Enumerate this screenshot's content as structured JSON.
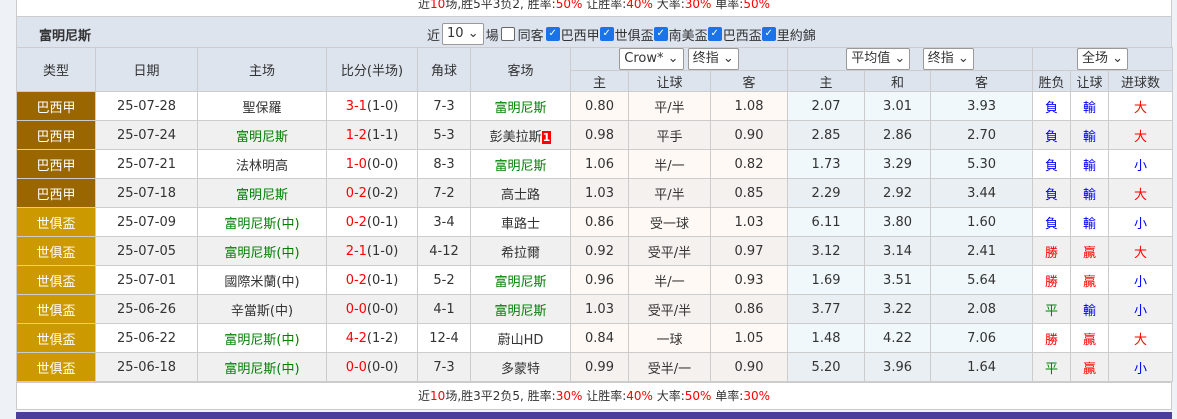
{
  "top_summary": {
    "p1": "近",
    "n": "10",
    "p2": "场,胜5平3负2, 胜率:",
    "win": "50%",
    "p3": " 让胜率:",
    "hwin": "40%",
    "p4": " 大率:",
    "big": "30%",
    "p5": " 单率:",
    "odd": "50%"
  },
  "bar": {
    "title": "富明尼斯",
    "near_label": "近",
    "count": "10",
    "games_label": "場",
    "same_away": "同客",
    "filters": [
      "巴西甲",
      "世俱盃",
      "南美盃",
      "巴西盃",
      "里約錦"
    ]
  },
  "header": {
    "type": "类型",
    "date": "日期",
    "home": "主场",
    "score": "比分(半场)",
    "corner": "角球",
    "away": "客场",
    "company": "Crow*",
    "odds_kind1": "终指",
    "avg": "平均值",
    "odds_kind2": "终指",
    "period": "全场",
    "sub": [
      "主",
      "让球",
      "客",
      "主",
      "和",
      "客",
      "胜负",
      "让球",
      "进球数"
    ]
  },
  "colors": {
    "巴西甲": "#996600",
    "世俱盃": "#cc9900",
    "win": "#ff0000",
    "draw": "#008000",
    "lose": "#0000ff"
  },
  "rows": [
    {
      "league": "巴西甲",
      "date": "25-07-28",
      "home": "聖保羅",
      "home_hl": false,
      "score": "3-1",
      "half": "(1-0)",
      "corner": "7-3",
      "away": "富明尼斯",
      "away_hl": true,
      "o": [
        "0.80",
        "平/半",
        "1.08",
        "2.07",
        "3.01",
        "3.93"
      ],
      "r": [
        "負",
        "輸",
        "大"
      ]
    },
    {
      "league": "巴西甲",
      "date": "25-07-24",
      "home": "富明尼斯",
      "home_hl": true,
      "score": "1-2",
      "half": "(1-1)",
      "corner": "5-3",
      "away": "彭美拉斯",
      "away_hl": false,
      "red_card": "1",
      "o": [
        "0.98",
        "平手",
        "0.90",
        "2.85",
        "2.86",
        "2.70"
      ],
      "r": [
        "負",
        "輸",
        "大"
      ]
    },
    {
      "league": "巴西甲",
      "date": "25-07-21",
      "home": "法林明高",
      "home_hl": false,
      "score": "1-0",
      "half": "(0-0)",
      "corner": "8-3",
      "away": "富明尼斯",
      "away_hl": true,
      "o": [
        "1.06",
        "半/一",
        "0.82",
        "1.73",
        "3.29",
        "5.30"
      ],
      "r": [
        "負",
        "輸",
        "小"
      ]
    },
    {
      "league": "巴西甲",
      "date": "25-07-18",
      "home": "富明尼斯",
      "home_hl": true,
      "score": "0-2",
      "half": "(0-2)",
      "corner": "7-2",
      "away": "高士路",
      "away_hl": false,
      "o": [
        "1.03",
        "平/半",
        "0.85",
        "2.29",
        "2.92",
        "3.44"
      ],
      "r": [
        "負",
        "輸",
        "大"
      ]
    },
    {
      "league": "世俱盃",
      "date": "25-07-09",
      "home": "富明尼斯(中)",
      "home_hl": true,
      "score": "0-2",
      "half": "(0-1)",
      "corner": "3-4",
      "away": "車路士",
      "away_hl": false,
      "o": [
        "0.86",
        "受一球",
        "1.03",
        "6.11",
        "3.80",
        "1.60"
      ],
      "r": [
        "負",
        "輸",
        "小"
      ]
    },
    {
      "league": "世俱盃",
      "date": "25-07-05",
      "home": "富明尼斯(中)",
      "home_hl": true,
      "score": "2-1",
      "half": "(1-0)",
      "corner": "4-12",
      "away": "希拉爾",
      "away_hl": false,
      "o": [
        "0.92",
        "受平/半",
        "0.97",
        "3.12",
        "3.14",
        "2.41"
      ],
      "r": [
        "勝",
        "贏",
        "大"
      ]
    },
    {
      "league": "世俱盃",
      "date": "25-07-01",
      "home": "國際米蘭(中)",
      "home_hl": false,
      "score": "0-2",
      "half": "(0-1)",
      "corner": "5-2",
      "away": "富明尼斯",
      "away_hl": true,
      "o": [
        "0.96",
        "半/一",
        "0.93",
        "1.69",
        "3.51",
        "5.64"
      ],
      "r": [
        "勝",
        "贏",
        "小"
      ]
    },
    {
      "league": "世俱盃",
      "date": "25-06-26",
      "home": "辛當斯(中)",
      "home_hl": false,
      "score": "0-0",
      "half": "(0-0)",
      "corner": "4-1",
      "away": "富明尼斯",
      "away_hl": true,
      "o": [
        "1.03",
        "受平/半",
        "0.86",
        "3.77",
        "3.22",
        "2.08"
      ],
      "r": [
        "平",
        "輸",
        "小"
      ]
    },
    {
      "league": "世俱盃",
      "date": "25-06-22",
      "home": "富明尼斯(中)",
      "home_hl": true,
      "score": "4-2",
      "half": "(1-2)",
      "corner": "12-4",
      "away": "蔚山HD",
      "away_hl": false,
      "o": [
        "0.84",
        "一球",
        "1.05",
        "1.48",
        "4.22",
        "7.06"
      ],
      "r": [
        "勝",
        "贏",
        "大"
      ]
    },
    {
      "league": "世俱盃",
      "date": "25-06-18",
      "home": "富明尼斯(中)",
      "home_hl": true,
      "score": "0-0",
      "half": "(0-0)",
      "corner": "7-3",
      "away": "多蒙特",
      "away_hl": false,
      "o": [
        "0.99",
        "受半/一",
        "0.90",
        "5.20",
        "3.96",
        "1.64"
      ],
      "r": [
        "平",
        "贏",
        "小"
      ]
    }
  ],
  "footer": {
    "p1": "近",
    "n": "10",
    "p2": "场,胜3平2负5, 胜率:",
    "win": "30%",
    "p3": " 让胜率:",
    "hwin": "40%",
    "p4": " 大率:",
    "big": "50%",
    "p5": " 单率:",
    "odd": "30%"
  }
}
